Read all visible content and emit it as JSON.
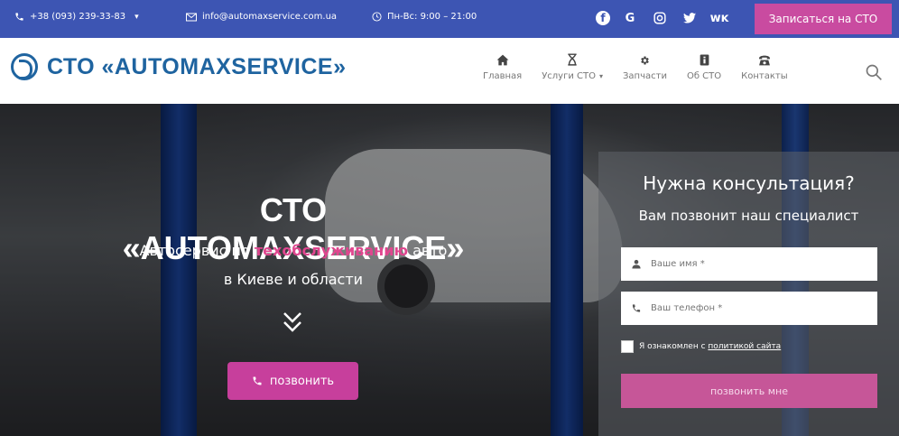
{
  "topbar": {
    "phone": "+38 (093) 239-33-83",
    "email": "info@automaxservice.com.ua",
    "hours": "Пн-Вс: 9:00 – 21:00",
    "socials": [
      "facebook-icon",
      "google-icon",
      "instagram-icon",
      "twitter-icon",
      "vk-icon"
    ],
    "cta": "Записаться на СТО"
  },
  "header": {
    "logo": "СТО «AUTOMAXSERVICE»",
    "nav": [
      {
        "label": "Главная",
        "icon": "home-icon"
      },
      {
        "label": "Услуги СТО",
        "icon": "services-icon"
      },
      {
        "label": "Запчасти",
        "icon": "gear-icon"
      },
      {
        "label": "Об СТО",
        "icon": "info-icon"
      },
      {
        "label": "Контакты",
        "icon": "phone-icon"
      }
    ]
  },
  "hero": {
    "title": "СТО «AUTOMAXSERVICE»",
    "subtitle_before": "Автосервис по ",
    "subtitle_accent": "техобслуживанию",
    "subtitle_after": " авто",
    "subtitle_line2": "в Киеве и области",
    "call_button": "позвонить"
  },
  "form": {
    "title": "Нужна консультация?",
    "subtitle": "Вам позвонит наш специалист",
    "name_placeholder": "Ваше имя *",
    "phone_placeholder": "Ваш телефон *",
    "agree_prefix": "Я ознакомлен с ",
    "agree_link": "политикой сайта",
    "submit": "позвонить мне"
  },
  "colors": {
    "topbar": "#3d55b3",
    "accent": "#c94ba0",
    "logo": "#1f64a0"
  }
}
